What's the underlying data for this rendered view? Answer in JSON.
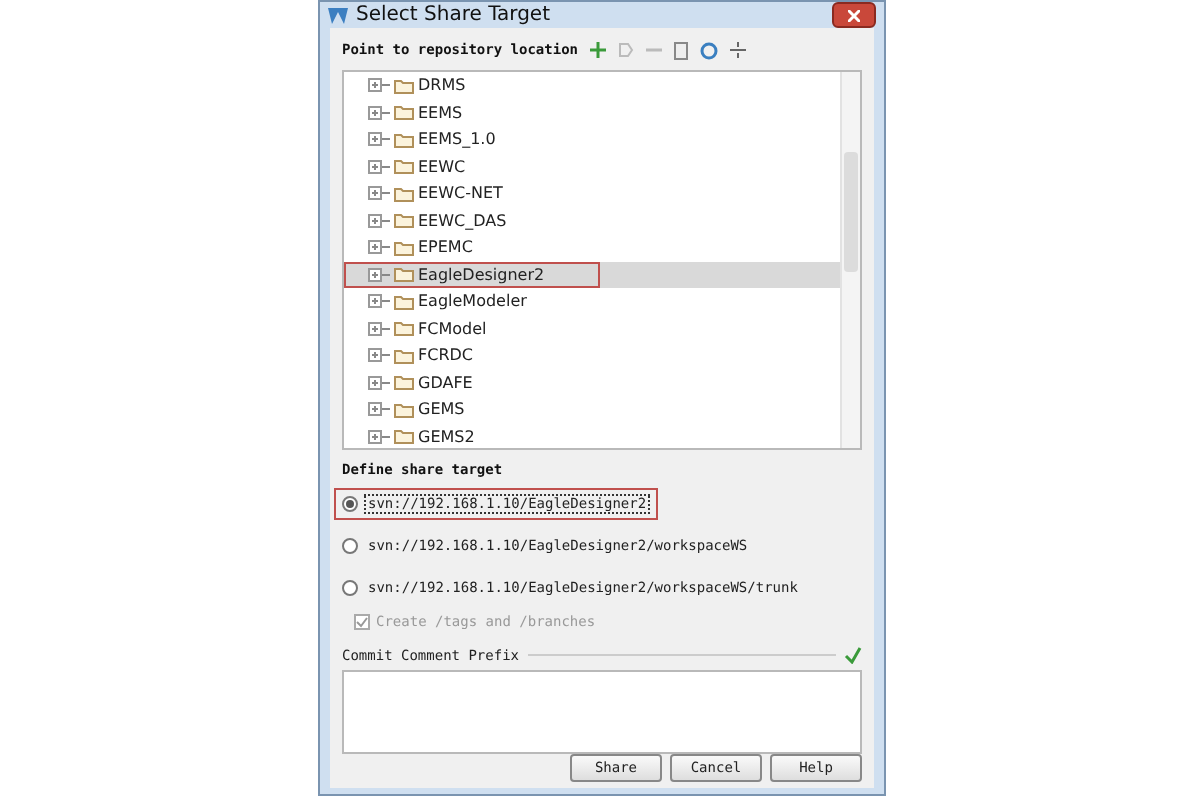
{
  "window": {
    "title": "Select Share Target"
  },
  "repository": {
    "label": "Point to repository location"
  },
  "tree": {
    "items": [
      {
        "label": "DRMS",
        "selected": false
      },
      {
        "label": "EEMS",
        "selected": false
      },
      {
        "label": "EEMS_1.0",
        "selected": false
      },
      {
        "label": "EEWC",
        "selected": false
      },
      {
        "label": "EEWC-NET",
        "selected": false
      },
      {
        "label": "EEWC_DAS",
        "selected": false
      },
      {
        "label": "EPEMC",
        "selected": false
      },
      {
        "label": "EagleDesigner2",
        "selected": true
      },
      {
        "label": "EagleModeler",
        "selected": false
      },
      {
        "label": "FCModel",
        "selected": false
      },
      {
        "label": "FCRDC",
        "selected": false
      },
      {
        "label": "GDAFE",
        "selected": false
      },
      {
        "label": "GEMS",
        "selected": false
      },
      {
        "label": "GEMS2",
        "selected": false
      }
    ]
  },
  "share_target": {
    "label": "Define share target",
    "options": [
      {
        "label": "svn://192.168.1.10/EagleDesigner2",
        "selected": true
      },
      {
        "label": "svn://192.168.1.10/EagleDesigner2/workspaceWS",
        "selected": false
      },
      {
        "label": "svn://192.168.1.10/EagleDesigner2/workspaceWS/trunk",
        "selected": false
      }
    ],
    "create_tags": {
      "label": "Create /tags and /branches",
      "checked": true,
      "disabled": true
    }
  },
  "comment": {
    "label": "Commit Comment Prefix"
  },
  "buttons": [
    "Share",
    "Cancel",
    "Help"
  ]
}
